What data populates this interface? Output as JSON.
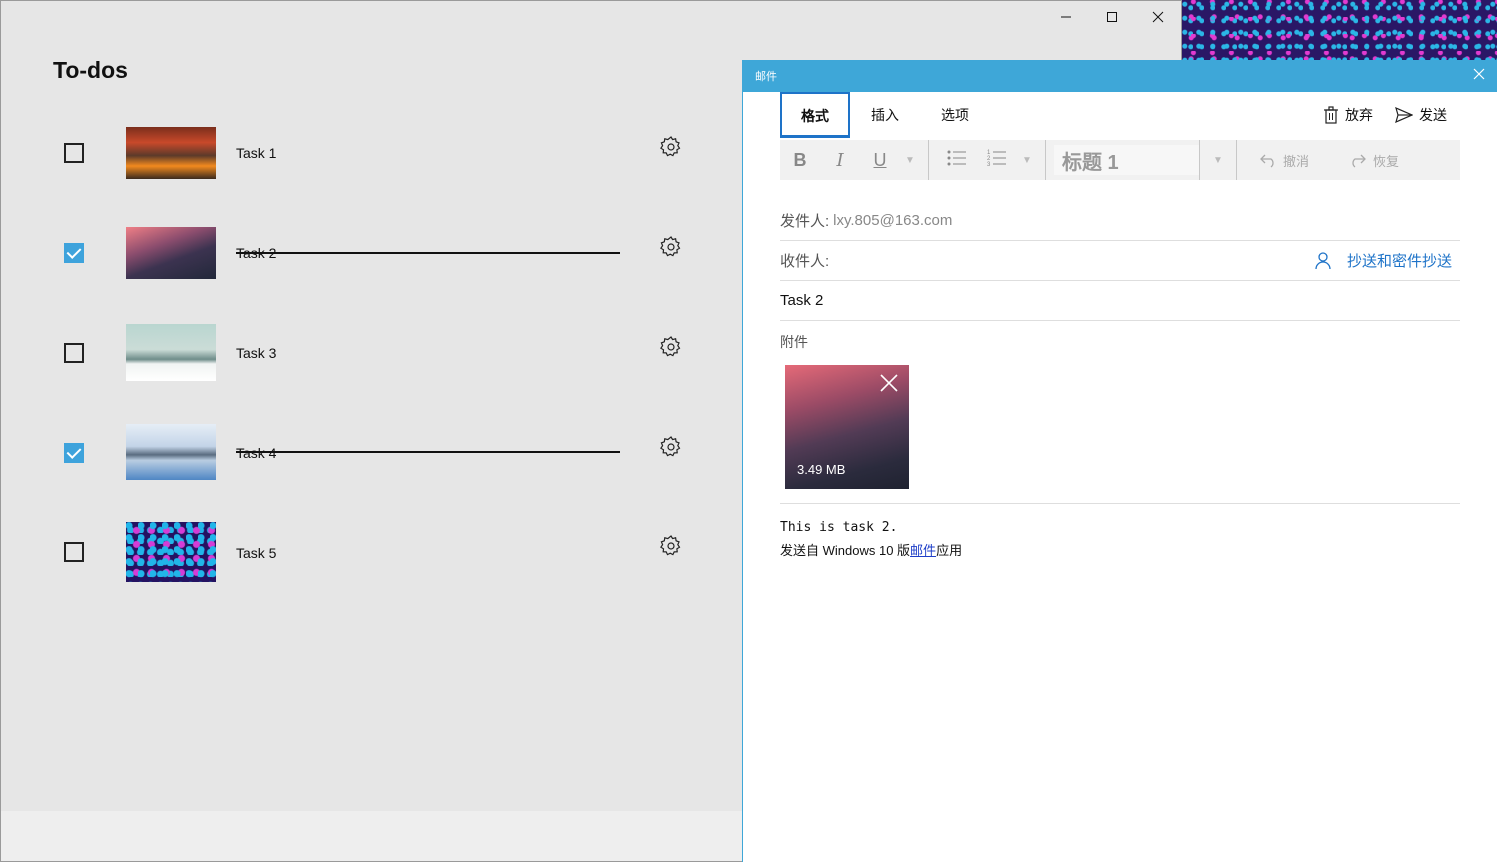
{
  "todo_app": {
    "title": "To-dos",
    "tasks": [
      {
        "label": "Task 1",
        "checked": false
      },
      {
        "label": "Task 2",
        "checked": true
      },
      {
        "label": "Task 3",
        "checked": false
      },
      {
        "label": "Task 4",
        "checked": true
      },
      {
        "label": "Task 5",
        "checked": false
      }
    ]
  },
  "mail": {
    "window_title": "邮件",
    "tabs": [
      "格式",
      "插入",
      "选项"
    ],
    "active_tab": "格式",
    "actions": {
      "discard": "放弃",
      "send": "发送"
    },
    "toolbar": {
      "bold": "B",
      "italic": "I",
      "underline": "U",
      "heading": "标题 1",
      "undo": "撤消",
      "redo": "恢复"
    },
    "from_label": "发件人:",
    "from_value": "lxy.805@163.com",
    "to_label": "收件人:",
    "cc_link": "抄送和密件抄送",
    "subject": "Task 2",
    "attachments_label": "附件",
    "attachment_size": "3.49 MB",
    "body_text": "This is task 2.",
    "signature_prefix": "发送自 Windows 10 版",
    "signature_link": "邮件",
    "signature_suffix": "应用"
  },
  "colors": {
    "accent": "#3ea7d8",
    "checkbox": "#3ea3dc",
    "link": "#1e73c8"
  }
}
